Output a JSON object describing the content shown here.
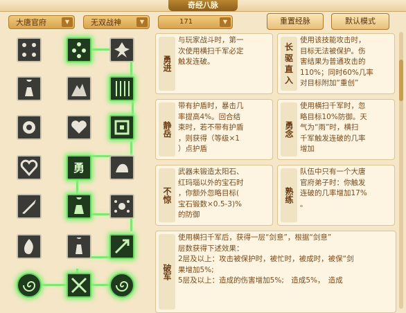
{
  "title": "奇经八脉",
  "toolbar": {
    "sect": "大唐官府",
    "mode": "无双战神",
    "points": "171",
    "reset_label": "重置经脉",
    "default_label": "默认模式"
  },
  "skills": [
    {
      "name": "勇进",
      "lines": [
        "与玩家战斗时，第一",
        "次使用横扫千军必定",
        "触发连破。"
      ]
    },
    {
      "name": "长驱直入",
      "lines": [
        "使用该技能攻击时，",
        "目标无法被保护。伤",
        "害结果为普通攻击的",
        "110%；同时60%几率",
        "对目标附加“重创”"
      ]
    },
    {
      "name": "静岳",
      "lines": [
        "带有护盾时，暴击几",
        "率提高4%。回合结",
        "束时，若不带有护盾",
        "，则获得（等级×1",
        "）点护盾"
      ]
    },
    {
      "name": "勇念",
      "lines": [
        "使用横扫千军时，忽",
        "略目标10%防御。天",
        "气为“雨”时，横扫",
        "千军触发连破的几率",
        "增加"
      ]
    },
    {
      "name": "不惊",
      "lines": [
        "武器未锻造太阳石、",
        "红玛瑙以外的宝石时",
        "，你额外忽略目标(",
        "宝石锻数×0.5-3)%",
        "的防御"
      ]
    },
    {
      "name": "熟练",
      "lines": [
        "队伍中只有一个大唐",
        "官府弟子时：你触发",
        "连破的几率增加17%",
        "。"
      ]
    },
    {
      "name": "破军",
      "lines": [
        "使用横扫千军后，获得一层“剑意”，根据“剑意”",
        "层数获得下述效果：",
        "2层及以上：攻击被保护时，被忙时，被成时，被保“剑",
        "果增加5%;",
        "5层及以上：造成的伤害增加5%;　造成5%，　造成",
        "　　　　　　　　　　　　　　　　　　　　　　　　　　"
      ]
    }
  ]
}
